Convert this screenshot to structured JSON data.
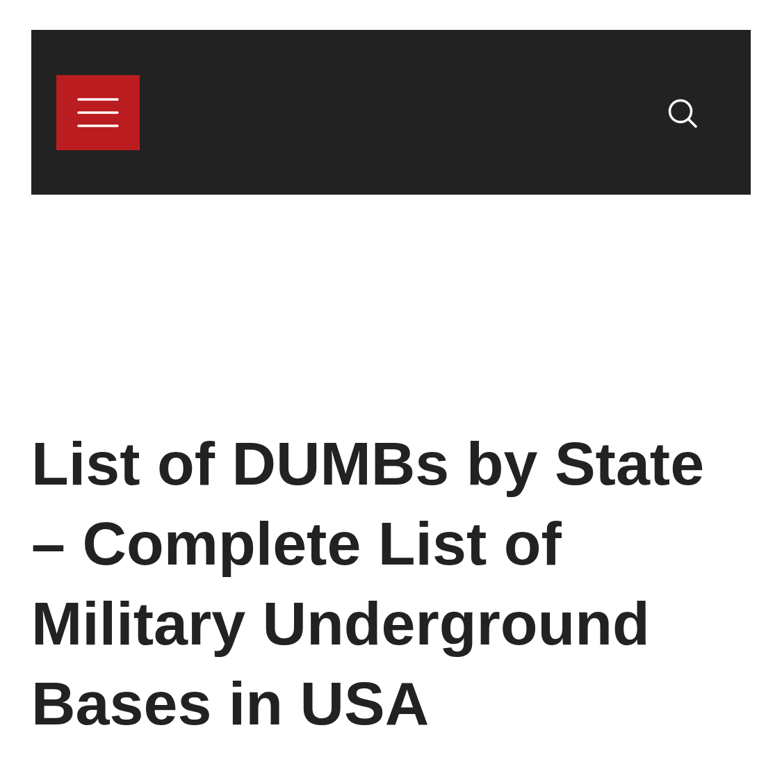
{
  "article": {
    "title": "List of DUMBs by State – Complete List of Military Underground Bases in USA"
  }
}
